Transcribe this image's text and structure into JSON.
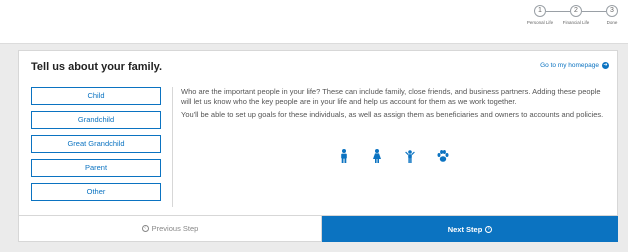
{
  "progress": {
    "steps": [
      {
        "number": "1",
        "label": "Personal Life"
      },
      {
        "number": "2",
        "label": "Financial Life"
      },
      {
        "number": "3",
        "label": "Done"
      }
    ]
  },
  "card": {
    "title": "Tell us about your family.",
    "home_link": "Go to my homepage"
  },
  "relationships": [
    "Child",
    "Grandchild",
    "Great Grandchild",
    "Parent",
    "Other"
  ],
  "description": {
    "paragraph1": "Who are the important people in your life? These can include family, close friends, and business partners. Adding these people will let us know who the key people are in your life and help us account for them as we work together.",
    "paragraph2": "You'll be able to set up goals for these individuals, as well as assign them as beneficiaries and owners to accounts and policies."
  },
  "icons": [
    "man-icon",
    "woman-icon",
    "child-icon",
    "paw-icon"
  ],
  "footer": {
    "previous_label": "Previous Step",
    "next_label": "Next Step"
  },
  "colors": {
    "accent": "#0b73c1",
    "background": "#ebebeb"
  }
}
